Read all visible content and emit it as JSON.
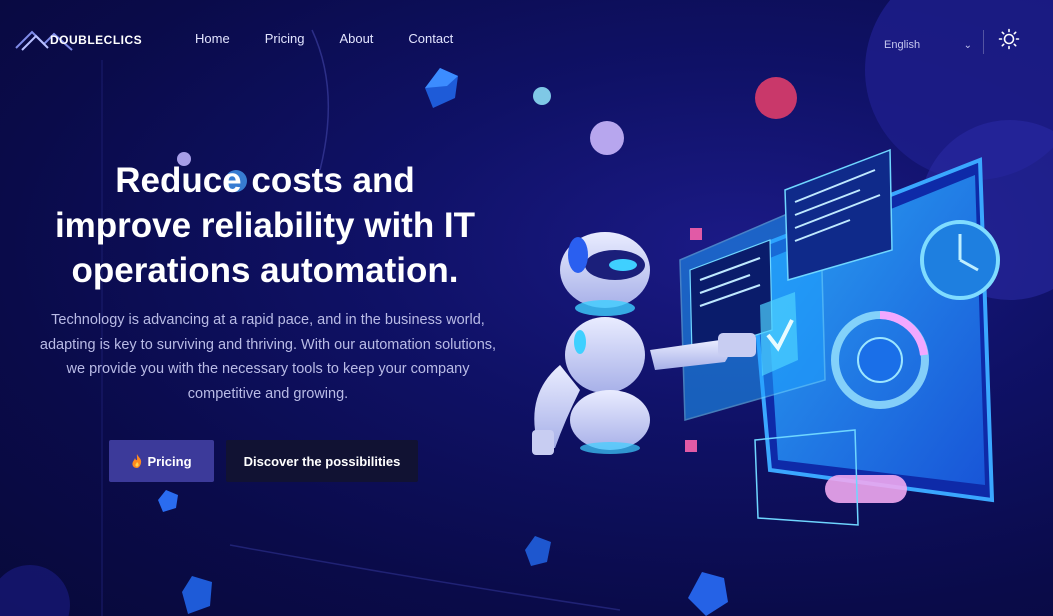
{
  "brand": {
    "name": "DOUBLECLICS",
    "logo_icon": "double-mountain-logo"
  },
  "nav": {
    "links": [
      {
        "label": "Home"
      },
      {
        "label": "Pricing"
      },
      {
        "label": "About"
      },
      {
        "label": "Contact"
      }
    ],
    "language": {
      "selected": "English",
      "icon": "chevron-down-icon"
    },
    "theme_icon": "sun-icon"
  },
  "hero": {
    "title_line1": "Reduce costs and",
    "title_line2": "improve reliability with IT",
    "title_line3": "operations automation.",
    "description": "Technology is advancing at a rapid pace, and in the business world, adapting is key to surviving and thriving. With our automation solutions, we provide you with the necessary tools to keep your company competitive and growing.",
    "primary_button": {
      "icon": "fire-icon",
      "label": "Pricing"
    },
    "secondary_button": {
      "label": "Discover the possibilities"
    }
  },
  "colors": {
    "background": "#0f1166",
    "primary_button": "#3c3a9a",
    "secondary_button": "#111233",
    "accent_cyan": "#3fd0ff",
    "accent_pink": "#c9386a"
  }
}
